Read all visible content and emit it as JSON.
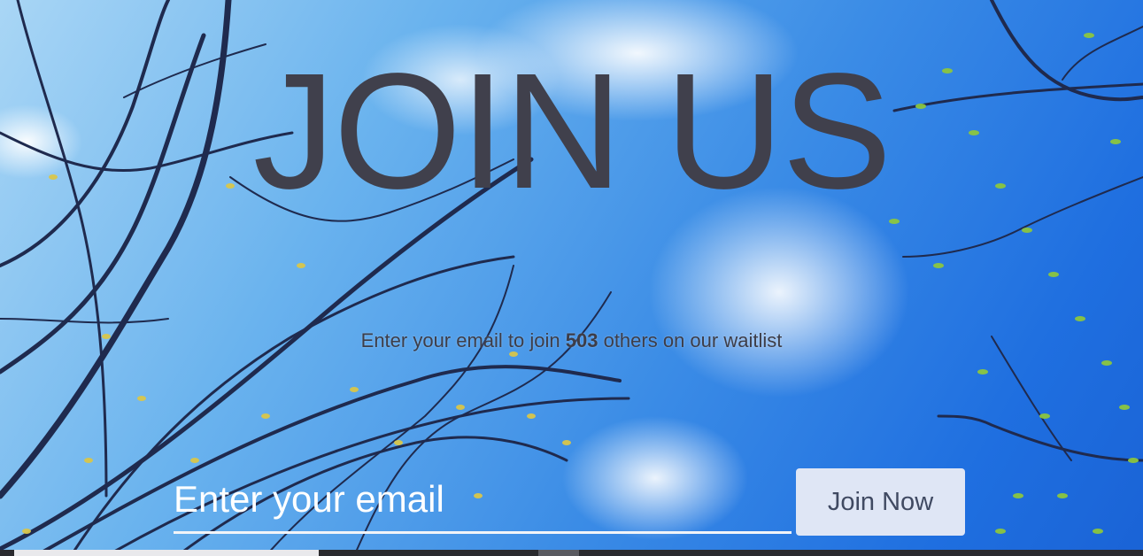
{
  "hero": {
    "title": "JOIN US",
    "subtitle_prefix": "Enter your email to join ",
    "subtitle_count": "503",
    "subtitle_suffix": " others on our waitlist"
  },
  "form": {
    "email_placeholder": "Enter your email",
    "email_value": "",
    "submit_label": "Join Now"
  },
  "colors": {
    "title": "#40404c",
    "button_bg": "#dfe6f5",
    "button_text": "#404a62",
    "input_underline": "#f2f4f8"
  }
}
